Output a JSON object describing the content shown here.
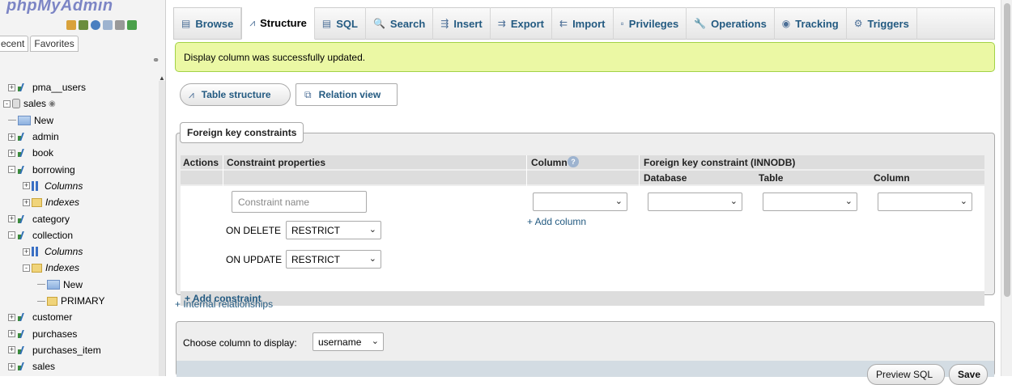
{
  "nav": {
    "logo_text": "phpMyAdmin",
    "tabs": [
      "ecent",
      "Favorites"
    ],
    "tree": [
      {
        "label": "pma__users",
        "type": "table",
        "indent": 1,
        "expander": "+"
      },
      {
        "label": "sales",
        "type": "db",
        "indent": 0,
        "expander": "-",
        "extra": "eye"
      },
      {
        "label": "New",
        "type": "new",
        "indent": 1,
        "expander": ""
      },
      {
        "label": "admin",
        "type": "table",
        "indent": 1,
        "expander": "+"
      },
      {
        "label": "book",
        "type": "table",
        "indent": 1,
        "expander": "+"
      },
      {
        "label": "borrowing",
        "type": "table",
        "indent": 1,
        "expander": "-"
      },
      {
        "label": "Columns",
        "type": "columns",
        "indent": 2,
        "expander": "+"
      },
      {
        "label": "Indexes",
        "type": "indexes",
        "indent": 2,
        "expander": "+"
      },
      {
        "label": "category",
        "type": "table",
        "indent": 1,
        "expander": "+"
      },
      {
        "label": "collection",
        "type": "table",
        "indent": 1,
        "expander": "-"
      },
      {
        "label": "Columns",
        "type": "columns",
        "indent": 2,
        "expander": "+"
      },
      {
        "label": "Indexes",
        "type": "indexes",
        "indent": 2,
        "expander": "-"
      },
      {
        "label": "New",
        "type": "new",
        "indent": 3,
        "expander": ""
      },
      {
        "label": "PRIMARY",
        "type": "index",
        "indent": 3,
        "expander": ""
      },
      {
        "label": "customer",
        "type": "table",
        "indent": 1,
        "expander": "+"
      },
      {
        "label": "purchases",
        "type": "table",
        "indent": 1,
        "expander": "+"
      },
      {
        "label": "purchases_item",
        "type": "table",
        "indent": 1,
        "expander": "+"
      },
      {
        "label": "sales",
        "type": "table",
        "indent": 1,
        "expander": "+"
      }
    ]
  },
  "topmenu": {
    "tabs": [
      {
        "label": "Browse",
        "icon": "browse-icon",
        "glyph": "▤",
        "active": false
      },
      {
        "label": "Structure",
        "icon": "structure-icon",
        "glyph": "⩘",
        "active": true
      },
      {
        "label": "SQL",
        "icon": "sql-icon",
        "glyph": "▤",
        "active": false
      },
      {
        "label": "Search",
        "icon": "search-icon",
        "glyph": "🔍",
        "active": false
      },
      {
        "label": "Insert",
        "icon": "insert-icon",
        "glyph": "⇶",
        "active": false
      },
      {
        "label": "Export",
        "icon": "export-icon",
        "glyph": "⇉",
        "active": false
      },
      {
        "label": "Import",
        "icon": "import-icon",
        "glyph": "⇇",
        "active": false
      },
      {
        "label": "Privileges",
        "icon": "privileges-icon",
        "glyph": "▫",
        "active": false
      },
      {
        "label": "Operations",
        "icon": "wrench-icon",
        "glyph": "🔧",
        "active": false
      },
      {
        "label": "Tracking",
        "icon": "eye-icon",
        "glyph": "◉",
        "active": false
      },
      {
        "label": "Triggers",
        "icon": "triggers-icon",
        "glyph": "⚙",
        "active": false
      }
    ]
  },
  "message": {
    "success": "Display column was successfully updated."
  },
  "subnav": {
    "table_structure": "Table structure",
    "relation_view": "Relation view"
  },
  "fk": {
    "legend": "Foreign key constraints",
    "headers": {
      "actions": "Actions",
      "constraint_properties": "Constraint properties",
      "column": "Column",
      "fk_innodb": "Foreign key constraint (INNODB)",
      "database": "Database",
      "table": "Table",
      "column2": "Column"
    },
    "constraint_name_placeholder": "Constraint name",
    "on_delete_label": "ON DELETE",
    "on_delete_value": "RESTRICT",
    "on_update_label": "ON UPDATE",
    "on_update_value": "RESTRICT",
    "add_column": "+ Add column",
    "add_constraint": "+ Add constraint"
  },
  "internal_relationships": "+ Internal relationships",
  "display": {
    "label": "Choose column to display:",
    "value": "username",
    "preview_sql": "Preview SQL",
    "save": "Save"
  },
  "colors": {
    "link": "#235a81",
    "success_bg": "#ebf8a4",
    "success_border": "#a2d246",
    "header_bg": "#dddddd"
  }
}
